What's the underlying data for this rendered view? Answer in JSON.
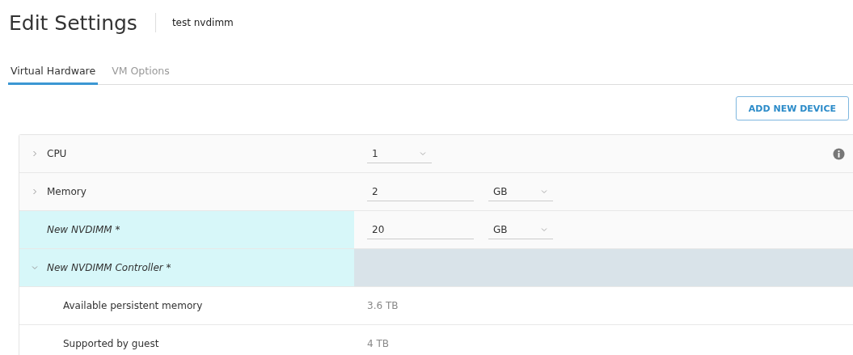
{
  "header": {
    "title": "Edit Settings",
    "subtitle": "test nvdimm"
  },
  "tabs": [
    {
      "label": "Virtual Hardware",
      "selected": true
    },
    {
      "label": "VM Options",
      "selected": false
    }
  ],
  "add_button": "ADD NEW DEVICE",
  "rows": [
    {
      "label": "CPU",
      "kind": "select",
      "value": "1",
      "expanded": false,
      "new": false,
      "info": true
    },
    {
      "label": "Memory",
      "kind": "size",
      "value": "2",
      "unit": "GB",
      "expanded": false,
      "new": false
    },
    {
      "label": "New NVDIMM *",
      "kind": "size",
      "value": "20",
      "unit": "GB",
      "new": true
    },
    {
      "label": "New NVDIMM Controller *",
      "kind": "group",
      "expanded": true,
      "new": true,
      "children": [
        {
          "label": "Available persistent memory",
          "kind": "text",
          "value": "3.6 TB"
        },
        {
          "label": "Supported by guest",
          "kind": "text",
          "value": "4 TB"
        }
      ]
    }
  ]
}
